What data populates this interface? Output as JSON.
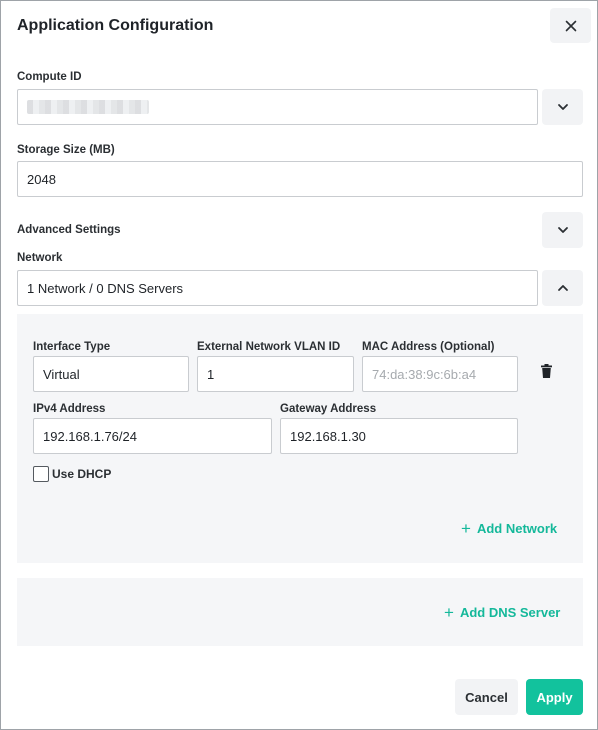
{
  "dialog": {
    "title": "Application Configuration",
    "close_icon": "close-icon"
  },
  "compute": {
    "label": "Compute ID",
    "value_redacted": true,
    "dropdown_icon": "chevron-down-icon"
  },
  "storage": {
    "label": "Storage Size (MB)",
    "value": "2048"
  },
  "advanced": {
    "label": "Advanced Settings",
    "toggle_icon": "chevron-down-icon"
  },
  "network": {
    "label": "Network",
    "summary": "1 Network / 0 DNS Servers",
    "toggle_icon": "chevron-up-icon",
    "interface": {
      "type_label": "Interface Type",
      "type_value": "Virtual",
      "vlan_label": "External Network VLAN ID",
      "vlan_value": "1",
      "mac_label": "MAC Address (Optional)",
      "mac_placeholder": "74:da:38:9c:6b:a4",
      "ipv4_label": "IPv4 Address",
      "ipv4_value": "192.168.1.76/24",
      "gateway_label": "Gateway Address",
      "gateway_value": "192.168.1.30",
      "dhcp_label": "Use DHCP",
      "dhcp_checked": false,
      "delete_icon": "trash-icon"
    },
    "add_network_label": "Add Network",
    "add_dns_label": "Add DNS Server"
  },
  "footer": {
    "cancel_label": "Cancel",
    "apply_label": "Apply"
  },
  "colors": {
    "accent": "#12c29d",
    "link": "#14b89a",
    "panel_bg": "#f5f6f8",
    "button_bg": "#f2f3f5"
  }
}
